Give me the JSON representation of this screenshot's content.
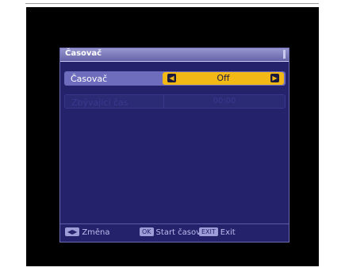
{
  "window": {
    "title": "Časovač"
  },
  "rows": [
    {
      "label": "Časovač",
      "value": "Off",
      "left_arrow": "◀",
      "right_arrow": "▶"
    },
    {
      "label": "Zbývající čas",
      "value": "00:00"
    }
  ],
  "footer": {
    "change": {
      "key": "◀▶",
      "label": "Změna"
    },
    "start": {
      "key": "OK",
      "label": "Start časova"
    },
    "exit": {
      "key": "EXIT",
      "label": "Exit"
    }
  },
  "colors": {
    "panel": "#23226a",
    "highlight": "#6e6dbd",
    "value_box": "#f2b816",
    "tv_frame": "#000000"
  }
}
